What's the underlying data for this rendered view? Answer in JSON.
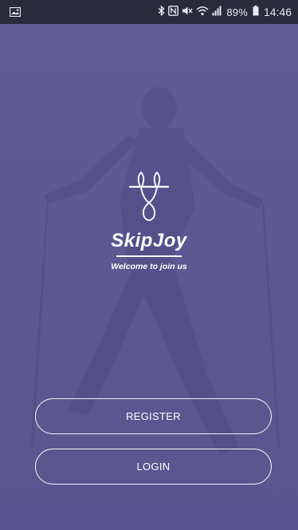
{
  "status_bar": {
    "battery_percent": "89%",
    "time": "14:46",
    "icons": [
      "gallery-icon",
      "bluetooth-icon",
      "nfc-icon",
      "mute-icon",
      "wifi-icon",
      "signal-icon",
      "battery-icon"
    ]
  },
  "brand": {
    "app_name": "SkipJoy",
    "tagline": "Welcome to join us",
    "logo_icon": "jump-rope-icon"
  },
  "actions": {
    "register_label": "REGISTER",
    "login_label": "LOGIN"
  },
  "colors": {
    "background": "#5f5a93",
    "status_bar": "#292a3c",
    "foreground": "#ffffff"
  }
}
